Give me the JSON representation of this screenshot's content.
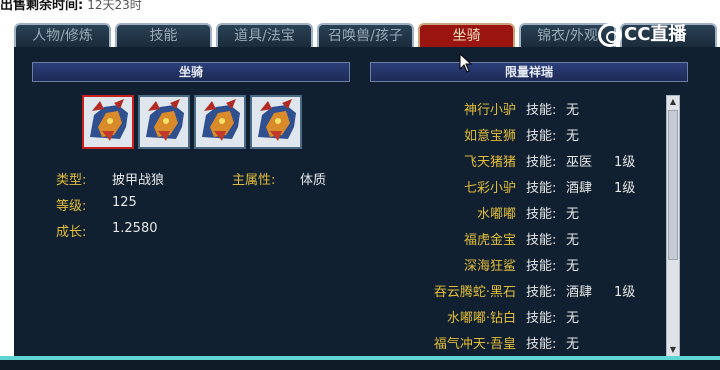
{
  "header": {
    "label": "出售剩余时间:",
    "value": "12天23时"
  },
  "tabs": [
    {
      "label": "人物/修炼",
      "active": false
    },
    {
      "label": "技能",
      "active": false
    },
    {
      "label": "道具/法宝",
      "active": false
    },
    {
      "label": "召唤兽/孩子",
      "active": false
    },
    {
      "label": "坐骑",
      "active": true
    },
    {
      "label": "锦衣/外观",
      "active": false
    },
    {
      "label": "CC直播",
      "active": false
    }
  ],
  "watermark": {
    "text": "CC直播"
  },
  "left_section": {
    "title": "坐骑",
    "slots": [
      {
        "icon": "mount-beast-icon",
        "selected": true
      },
      {
        "icon": "mount-beast-icon",
        "selected": false
      },
      {
        "icon": "mount-beast-icon",
        "selected": false
      },
      {
        "icon": "mount-beast-icon",
        "selected": false
      }
    ],
    "type_label": "类型:",
    "type_value": "披甲战狼",
    "main_attr_label": "主属性:",
    "main_attr_value": "体质",
    "level_label": "等级:",
    "level_value": "125",
    "growth_label": "成长:",
    "growth_value": "1.2580"
  },
  "right_section": {
    "title": "限量祥瑞",
    "items": [
      {
        "name": "神行小驴",
        "skill_label": "技能:",
        "skill_value": "无",
        "level": ""
      },
      {
        "name": "如意宝狮",
        "skill_label": "技能:",
        "skill_value": "无",
        "level": ""
      },
      {
        "name": "飞天猪猪",
        "skill_label": "技能:",
        "skill_value": "巫医",
        "level": "1级"
      },
      {
        "name": "七彩小驴",
        "skill_label": "技能:",
        "skill_value": "酒肆",
        "level": "1级"
      },
      {
        "name": "水嘟嘟",
        "skill_label": "技能:",
        "skill_value": "无",
        "level": ""
      },
      {
        "name": "福虎金宝",
        "skill_label": "技能:",
        "skill_value": "无",
        "level": ""
      },
      {
        "name": "深海狂鲨",
        "skill_label": "技能:",
        "skill_value": "无",
        "level": ""
      },
      {
        "name": "吞云腾蛇·黑石",
        "skill_label": "技能:",
        "skill_value": "酒肆",
        "level": "1级"
      },
      {
        "name": "水嘟嘟·钻白",
        "skill_label": "技能:",
        "skill_value": "无",
        "level": ""
      },
      {
        "name": "福气冲天·吾皇",
        "skill_label": "技能:",
        "skill_value": "无",
        "level": ""
      }
    ]
  },
  "colors": {
    "panel_bg": "#102030",
    "accent_gold": "#e2bd3a",
    "active_tab": "#9a1410",
    "bottom_line": "#5fd6d4"
  }
}
